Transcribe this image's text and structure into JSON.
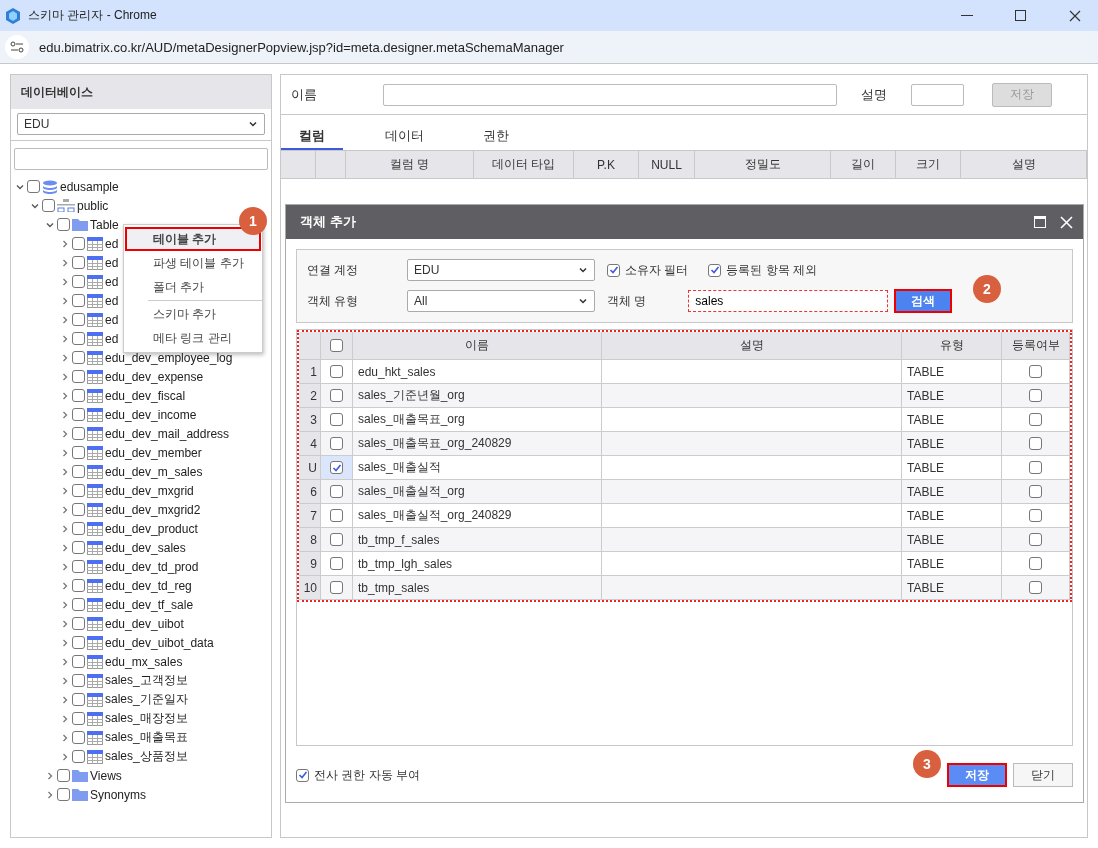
{
  "window": {
    "title": "스키마 관리자 - Chrome",
    "url": "edu.bimatrix.co.kr/AUD/metaDesignerPopview.jsp?id=meta.designer.metaSchemaManager"
  },
  "sidebar": {
    "title": "데이터베이스",
    "database": "EDU",
    "tree": [
      {
        "label": "edusample",
        "kind": "database",
        "expanded": true,
        "checked": false,
        "children": [
          {
            "label": "public",
            "kind": "schema",
            "expanded": true,
            "checked": false,
            "children": [
              {
                "label": "Table",
                "kind": "folder",
                "expanded": true,
                "checked": false,
                "children": [
                  {
                    "label": "ed",
                    "kind": "table",
                    "expanded": false,
                    "checked": false
                  },
                  {
                    "label": "ed",
                    "kind": "table",
                    "expanded": false,
                    "checked": false
                  },
                  {
                    "label": "ed",
                    "kind": "table",
                    "expanded": false,
                    "checked": false
                  },
                  {
                    "label": "ed",
                    "kind": "table",
                    "expanded": false,
                    "checked": false
                  },
                  {
                    "label": "ed",
                    "kind": "table",
                    "expanded": false,
                    "checked": false
                  },
                  {
                    "label": "ed",
                    "kind": "table",
                    "expanded": false,
                    "checked": false
                  },
                  {
                    "label": "edu_dev_employee_log",
                    "kind": "table",
                    "expanded": false,
                    "checked": false
                  },
                  {
                    "label": "edu_dev_expense",
                    "kind": "table",
                    "expanded": false,
                    "checked": false
                  },
                  {
                    "label": "edu_dev_fiscal",
                    "kind": "table",
                    "expanded": false,
                    "checked": false
                  },
                  {
                    "label": "edu_dev_income",
                    "kind": "table",
                    "expanded": false,
                    "checked": false
                  },
                  {
                    "label": "edu_dev_mail_address",
                    "kind": "table",
                    "expanded": false,
                    "checked": false
                  },
                  {
                    "label": "edu_dev_member",
                    "kind": "table",
                    "expanded": false,
                    "checked": false
                  },
                  {
                    "label": "edu_dev_m_sales",
                    "kind": "table",
                    "expanded": false,
                    "checked": false
                  },
                  {
                    "label": "edu_dev_mxgrid",
                    "kind": "table",
                    "expanded": false,
                    "checked": false
                  },
                  {
                    "label": "edu_dev_mxgrid2",
                    "kind": "table",
                    "expanded": false,
                    "checked": false
                  },
                  {
                    "label": "edu_dev_product",
                    "kind": "table",
                    "expanded": false,
                    "checked": false
                  },
                  {
                    "label": "edu_dev_sales",
                    "kind": "table",
                    "expanded": false,
                    "checked": false
                  },
                  {
                    "label": "edu_dev_td_prod",
                    "kind": "table",
                    "expanded": false,
                    "checked": false
                  },
                  {
                    "label": "edu_dev_td_reg",
                    "kind": "table",
                    "expanded": false,
                    "checked": false
                  },
                  {
                    "label": "edu_dev_tf_sale",
                    "kind": "table",
                    "expanded": false,
                    "checked": false
                  },
                  {
                    "label": "edu_dev_uibot",
                    "kind": "table",
                    "expanded": false,
                    "checked": false
                  },
                  {
                    "label": "edu_dev_uibot_data",
                    "kind": "table",
                    "expanded": false,
                    "checked": false
                  },
                  {
                    "label": "edu_mx_sales",
                    "kind": "table",
                    "expanded": false,
                    "checked": false
                  },
                  {
                    "label": "sales_고객정보",
                    "kind": "table",
                    "expanded": false,
                    "checked": false
                  },
                  {
                    "label": "sales_기준일자",
                    "kind": "table",
                    "expanded": false,
                    "checked": false
                  },
                  {
                    "label": "sales_매장정보",
                    "kind": "table",
                    "expanded": false,
                    "checked": false
                  },
                  {
                    "label": "sales_매출목표",
                    "kind": "table",
                    "expanded": false,
                    "checked": false
                  },
                  {
                    "label": "sales_상품정보",
                    "kind": "table",
                    "expanded": false,
                    "checked": false
                  }
                ]
              },
              {
                "label": "Views",
                "kind": "folder",
                "expanded": false,
                "checked": false
              },
              {
                "label": "Synonyms",
                "kind": "folder",
                "expanded": false,
                "checked": false
              }
            ]
          }
        ]
      }
    ]
  },
  "context_menu": {
    "groups": [
      [
        {
          "label": "테이블 추가",
          "selected": true,
          "step": "1"
        },
        {
          "label": "파생 테이블 추가",
          "selected": false
        },
        {
          "label": "폴더 추가",
          "selected": false
        }
      ],
      [
        {
          "label": "스키마 추가",
          "selected": false
        },
        {
          "label": "메타 링크 관리",
          "selected": false
        }
      ]
    ]
  },
  "form": {
    "name_label": "이름",
    "description_label": "설명",
    "save": {
      "label": "저장",
      "disabled": true
    }
  },
  "tabs": [
    {
      "label": "컬럼",
      "selected": true
    },
    {
      "label": "데이터",
      "selected": false
    },
    {
      "label": "권한",
      "selected": false
    }
  ],
  "columns": [
    "컬럼 명",
    "데이터 타입",
    "P.K",
    "NULL",
    "정밀도",
    "길이",
    "크기",
    "설명"
  ],
  "dialog": {
    "title": "객체 추가",
    "connection_label": "연결 계정",
    "connection": "EDU",
    "owner_filter": {
      "label": "소유자 필터",
      "checked": true
    },
    "exclude_registered": {
      "label": "등록된 항목 제외",
      "checked": true
    },
    "type_label": "객체 유형",
    "type": "All",
    "name_label": "객체 명",
    "name": "sales",
    "search": {
      "label": "검색",
      "step": "2"
    },
    "grid_columns": [
      "이름",
      "설명",
      "유형",
      "등록여부"
    ],
    "select_all": {
      "checked": false
    },
    "rows": [
      {
        "index": "1",
        "checked": false,
        "name": "edu_hkt_sales",
        "type": "TABLE",
        "registered": false
      },
      {
        "index": "2",
        "checked": false,
        "name": "sales_기준년월_org",
        "type": "TABLE",
        "registered": false
      },
      {
        "index": "3",
        "checked": false,
        "name": "sales_매출목표_org",
        "type": "TABLE",
        "registered": false
      },
      {
        "index": "4",
        "checked": false,
        "name": "sales_매출목표_org_240829",
        "type": "TABLE",
        "registered": false
      },
      {
        "index": "U",
        "checked": true,
        "name": "sales_매출실적",
        "type": "TABLE",
        "registered": false
      },
      {
        "index": "6",
        "checked": false,
        "name": "sales_매출실적_org",
        "type": "TABLE",
        "registered": false
      },
      {
        "index": "7",
        "checked": false,
        "name": "sales_매출실적_org_240829",
        "type": "TABLE",
        "registered": false
      },
      {
        "index": "8",
        "checked": false,
        "name": "tb_tmp_f_sales",
        "type": "TABLE",
        "registered": false
      },
      {
        "index": "9",
        "checked": false,
        "name": "tb_tmp_lgh_sales",
        "type": "TABLE",
        "registered": false
      },
      {
        "index": "10",
        "checked": false,
        "name": "tb_tmp_sales",
        "type": "TABLE",
        "registered": false
      }
    ],
    "auto_grant": {
      "label": "전사 권한 자동 부여",
      "checked": true
    },
    "save": {
      "label": "저장",
      "step": "3"
    },
    "close": {
      "label": "닫기"
    }
  }
}
